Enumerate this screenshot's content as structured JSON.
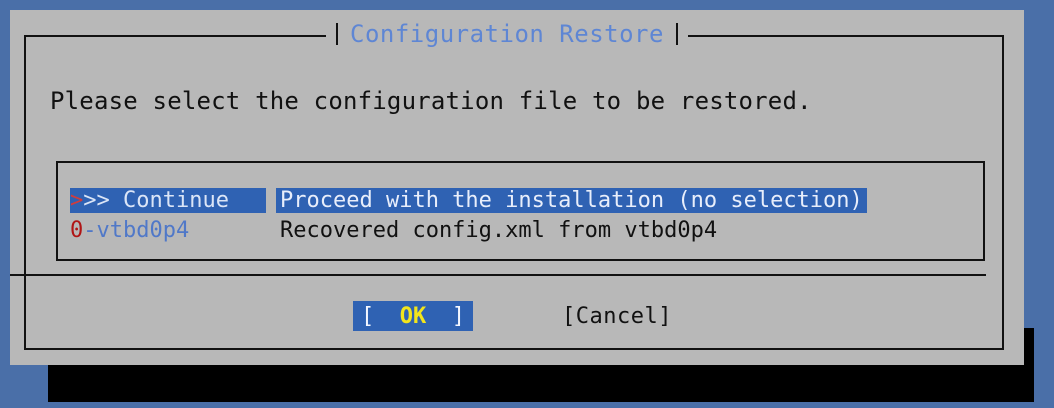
{
  "dialog": {
    "title": "Configuration Restore",
    "prompt": "Please select the configuration file to be restored."
  },
  "menu": {
    "items": [
      {
        "tag_first": ">",
        "tag_rest": ">> Continue",
        "description": "Proceed with the installation (no selection)",
        "selected": true
      },
      {
        "tag_first": "0",
        "tag_rest": "-vtbd0p4",
        "description": "Recovered config.xml from vtbd0p4",
        "selected": false
      }
    ]
  },
  "buttons": {
    "ok_left": "[",
    "ok_label": "OK",
    "ok_right": "]",
    "cancel_label": "[Cancel]"
  },
  "colors": {
    "background": "#4a6fa8",
    "dialog": "#b8b8b8",
    "selection": "#2f62b3",
    "title": "#5e86d4",
    "hotkey": "#b01515",
    "ok_label": "#f2e51c"
  }
}
